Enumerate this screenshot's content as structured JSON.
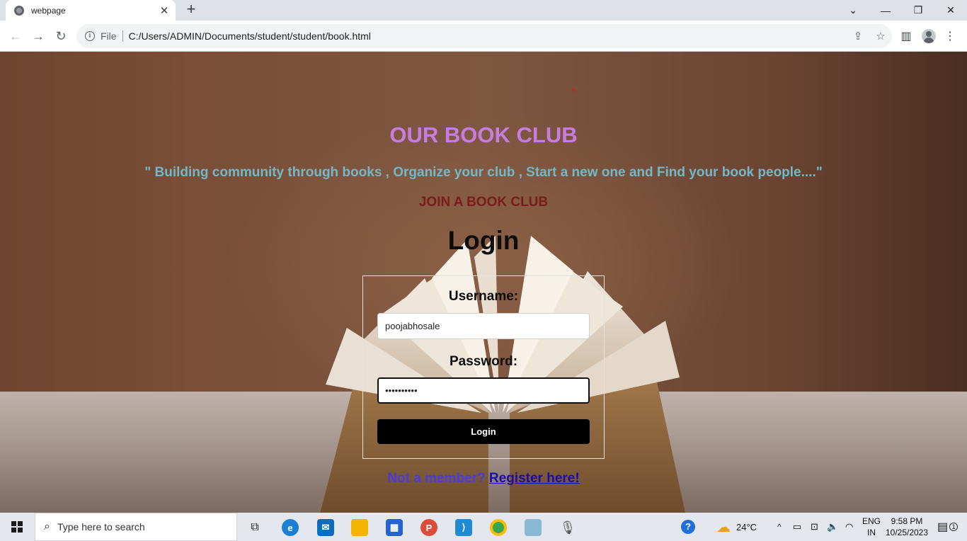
{
  "browser": {
    "tab_title": "webpage",
    "new_tab": "+",
    "address_scheme": "File",
    "url": "C:/Users/ADMIN/Documents/student/student/book.html"
  },
  "page": {
    "headline": "OUR BOOK CLUB",
    "tagline": "\" Building community through books , Organize your club , Start a new one and Find your book people....\"",
    "join": "JOIN A BOOK CLUB",
    "login_heading": "Login",
    "username_label": "Username:",
    "username_value": "poojabhosale",
    "password_label": "Password:",
    "password_value": "••••••••••",
    "login_button": "Login",
    "not_member": "Not a member?",
    "register_link": "Register here!"
  },
  "taskbar": {
    "search_placeholder": "Type here to search",
    "weather": "24°C",
    "lang_top": "ENG",
    "lang_bottom": "IN",
    "time": "9:58 PM",
    "date": "10/25/2023",
    "notification_count": "1"
  },
  "colors": {
    "headline": "#c77de0",
    "tagline": "#72b8c8",
    "join": "#7c1b1b",
    "login_button_bg": "#000000",
    "link": "#1a0dab"
  }
}
